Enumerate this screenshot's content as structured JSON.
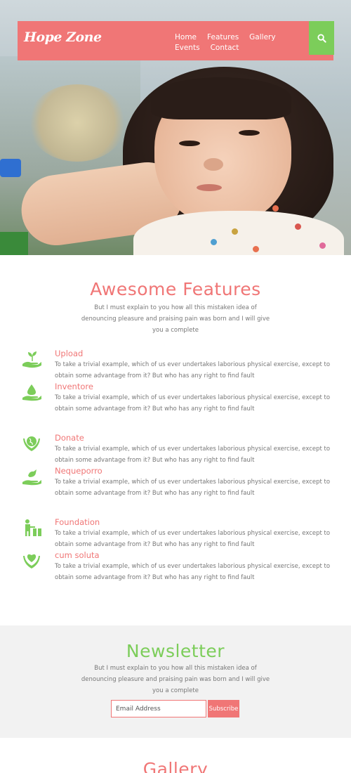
{
  "nav": {
    "logo": "Hope Zone",
    "menu": [
      {
        "label": "Home"
      },
      {
        "label": "Features"
      },
      {
        "label": "Gallery"
      },
      {
        "label": "Events"
      },
      {
        "label": "Contact"
      }
    ],
    "search_icon": "search-icon",
    "brand_color": "#f07676",
    "accent_color": "#7ccd5a"
  },
  "features": {
    "title": "Awesome Features",
    "description": "But I must explain to you how all this mistaken idea of denouncing pleasure and praising pain was born and I will give you a complete",
    "items": [
      {
        "icon": "hand-plant-icon",
        "title": "Upload",
        "text": "To take a trivial example, which of us ever undertakes laborious physical exercise, except to obtain some advantage from it? But who has any right to find fault"
      },
      {
        "icon": "hand-drop-icon",
        "title": "Inventore",
        "text": "To take a trivial example, which of us ever undertakes laborious physical exercise, except to obtain some advantage from it? But who has any right to find fault"
      },
      {
        "icon": "hands-globe-icon",
        "title": "Donate",
        "text": "To take a trivial example, which of us ever undertakes laborious physical exercise, except to obtain some advantage from it? But who has any right to find fault"
      },
      {
        "icon": "hand-bird-icon",
        "title": "Nequeporro",
        "text": "To take a trivial example, which of us ever undertakes laborious physical exercise, except to obtain some advantage from it? But who has any right to find fault"
      },
      {
        "icon": "person-gift-icon",
        "title": "Foundation",
        "text": "To take a trivial example, which of us ever undertakes laborious physical exercise, except to obtain some advantage from it? But who has any right to find fault"
      },
      {
        "icon": "hands-heart-icon",
        "title": "cum soluta",
        "text": "To take a trivial example, which of us ever undertakes laborious physical exercise, except to obtain some advantage from it? But who has any right to find fault"
      }
    ]
  },
  "newsletter": {
    "title": "Newsletter",
    "description": "But I must explain to you how all this mistaken idea of denouncing pleasure and praising pain was born and I will give you a complete",
    "placeholder": "Email Address",
    "button": "Subscribe"
  },
  "gallery": {
    "title": "Gallery"
  }
}
